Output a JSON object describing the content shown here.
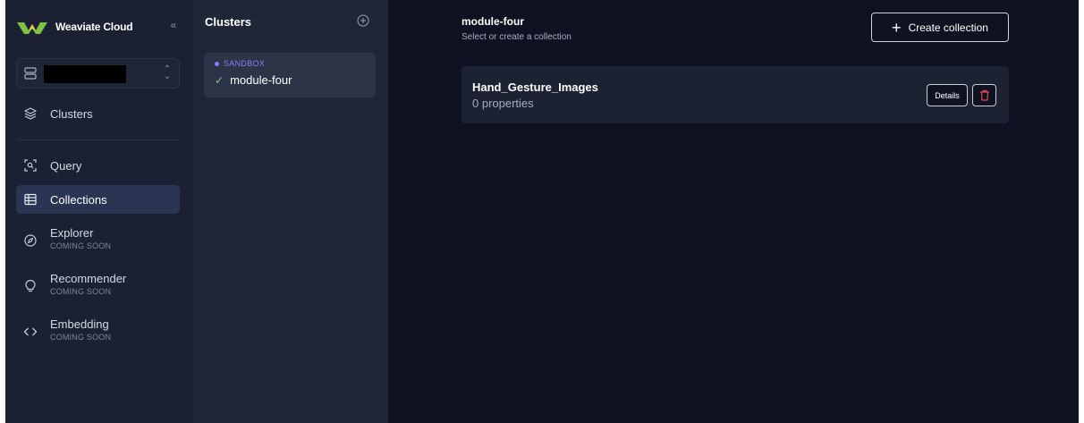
{
  "brand": {
    "name": "Weaviate Cloud",
    "logo_icon": "weaviate-logo-icon"
  },
  "sidebar": {
    "collapse_icon": "chevrons-left-icon",
    "cluster_select": {
      "icon": "server-icon",
      "chevron": "chevron-up-down-icon"
    },
    "items": [
      {
        "label": "Clusters",
        "icon": "layers-icon"
      },
      {
        "label": "Query",
        "icon": "scan-search-icon"
      },
      {
        "label": "Collections",
        "icon": "table-icon",
        "active": true
      },
      {
        "label": "Explorer",
        "sub": "COMING SOON",
        "icon": "compass-icon"
      },
      {
        "label": "Recommender",
        "sub": "COMING SOON",
        "icon": "lightbulb-icon"
      },
      {
        "label": "Embedding",
        "sub": "COMING SOON",
        "icon": "code-icon"
      }
    ]
  },
  "clusters_panel": {
    "title": "Clusters",
    "add_icon": "plus-circle-icon",
    "selected": {
      "tag": "SANDBOX",
      "name": "module-four",
      "status_icon": "check-icon"
    }
  },
  "main": {
    "title": "module-four",
    "subtitle": "Select or create a collection",
    "create_button": "Create collection",
    "collections": [
      {
        "name": "Hand_Gesture_Images",
        "properties": "0 properties",
        "details_label": "Details",
        "delete_icon": "trash-icon"
      }
    ]
  },
  "colors": {
    "sidebar_bg": "#1b2133",
    "panel_bg": "#1f2637",
    "main_bg": "#0f1221",
    "accent_purple": "#8a7bf6",
    "logo_green": "#7fc241",
    "danger_red": "#e5484d"
  }
}
